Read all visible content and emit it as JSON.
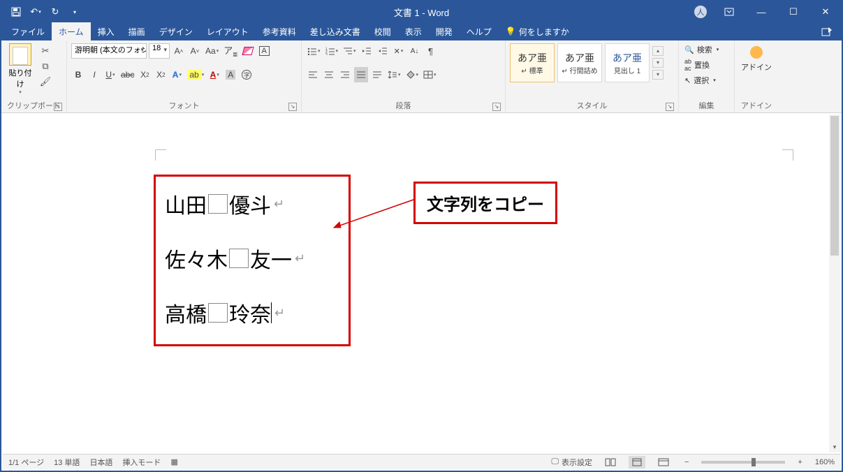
{
  "title": "文書 1 - Word",
  "qat": {
    "save": "save",
    "undo": "undo",
    "redo": "redo",
    "more": "more"
  },
  "tabs": {
    "file": "ファイル",
    "home": "ホーム",
    "insert": "挿入",
    "draw": "描画",
    "design": "デザイン",
    "layout": "レイアウト",
    "references": "参考資料",
    "mailings": "差し込み文書",
    "review": "校閲",
    "view": "表示",
    "developer": "開発",
    "help": "ヘルプ",
    "tell": "何をしますか"
  },
  "ribbon": {
    "clipboard": {
      "label": "クリップボード",
      "paste": "貼り付け"
    },
    "font": {
      "label": "フォント",
      "name": "游明朝 (本文のフォン",
      "size": "18"
    },
    "paragraph": {
      "label": "段落"
    },
    "styles": {
      "label": "スタイル",
      "sample": "あア亜",
      "items": [
        {
          "name": "標準",
          "active": true,
          "marker": "↵"
        },
        {
          "name": "行間詰め",
          "marker": "↵"
        },
        {
          "name": "見出し 1",
          "class": "h1"
        }
      ]
    },
    "editing": {
      "label": "編集",
      "find": "検索",
      "replace": "置換",
      "select": "選択"
    },
    "addin": {
      "label": "アドイン",
      "btn": "アドイン"
    }
  },
  "document": {
    "lines": [
      {
        "pre": "山田",
        "post": "優斗",
        "ret": true
      },
      {
        "pre": "佐々木",
        "post": "友一",
        "ret": true
      },
      {
        "pre": "高橋",
        "post": "玲奈",
        "ret": true,
        "cursor": true
      }
    ],
    "callout": "文字列をコピー"
  },
  "status": {
    "page": "1/1 ページ",
    "words": "13 単語",
    "lang": "日本語",
    "mode": "挿入モード",
    "display": "表示設定",
    "zoom": "160%"
  }
}
